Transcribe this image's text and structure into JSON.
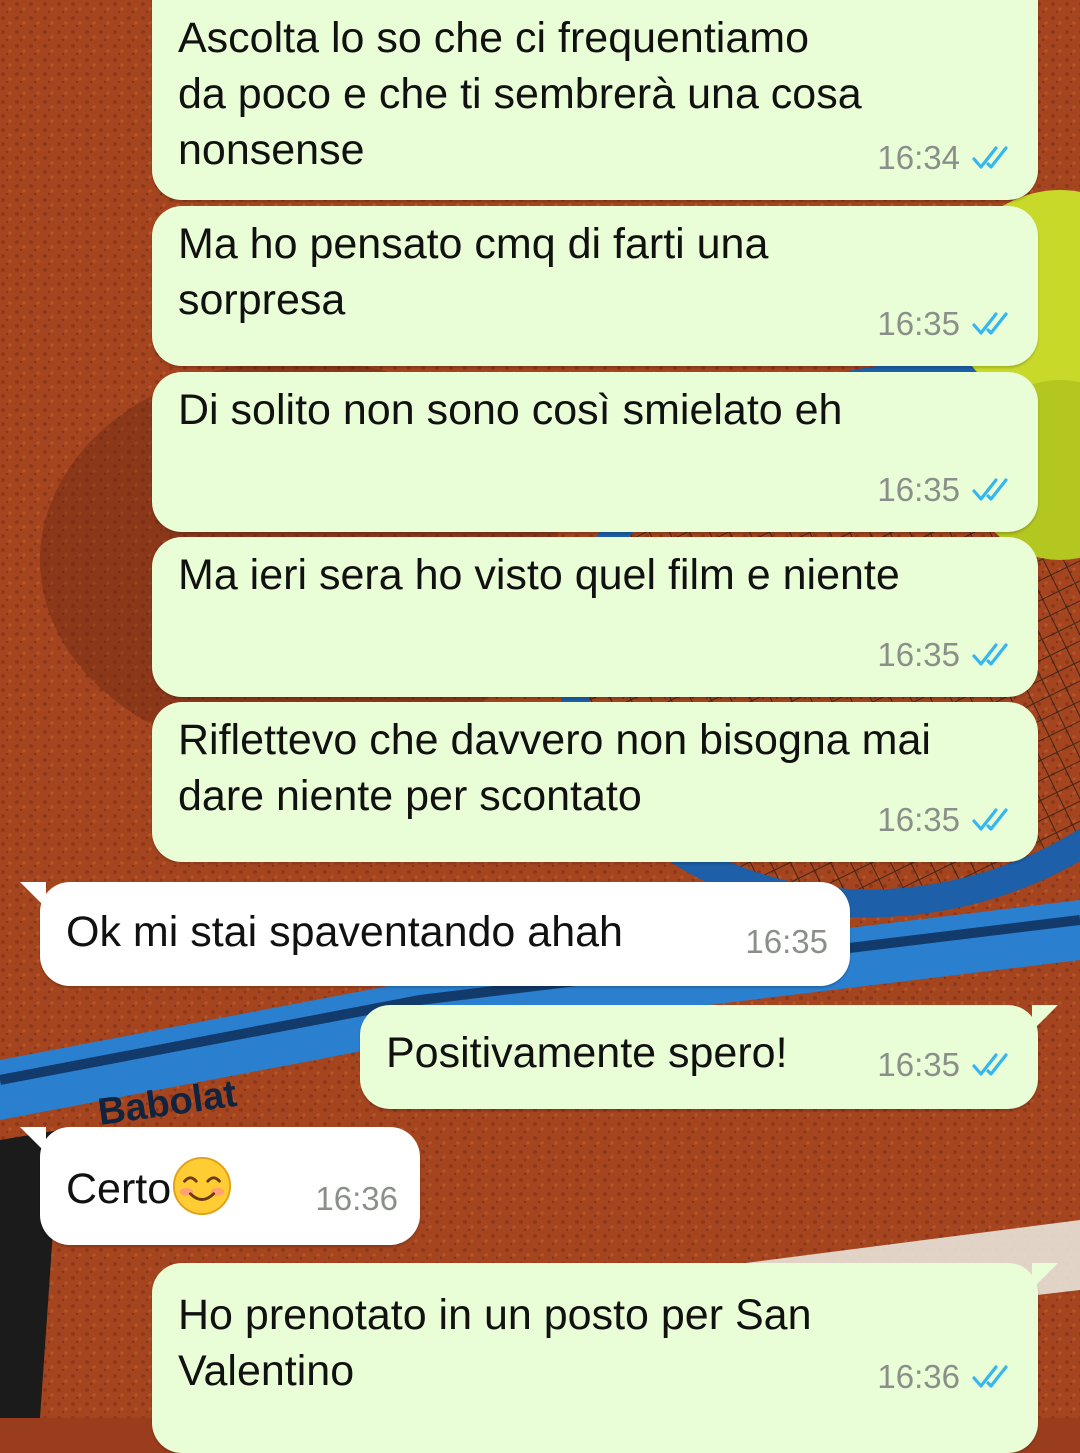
{
  "chat": {
    "messages": [
      {
        "direction": "out",
        "text": "Ascolta lo so che ci frequentiamo\nda poco e che ti sembrerà una cosa\nnonsense",
        "time": "16:34",
        "status": "read"
      },
      {
        "direction": "out",
        "text": "Ma ho pensato cmq di farti una\nsorpresa",
        "time": "16:35",
        "status": "read"
      },
      {
        "direction": "out",
        "text": "Di solito non sono così smielato eh",
        "time": "16:35",
        "status": "read"
      },
      {
        "direction": "out",
        "text": "Ma ieri sera ho visto quel film e niente",
        "time": "16:35",
        "status": "read"
      },
      {
        "direction": "out",
        "text": "Riflettevo che davvero non bisogna mai\ndare niente per scontato",
        "time": "16:35",
        "status": "read"
      },
      {
        "direction": "in",
        "text": "Ok mi stai spaventando ahah",
        "time": "16:35"
      },
      {
        "direction": "out",
        "text": "Positivamente spero!",
        "time": "16:35",
        "status": "read"
      },
      {
        "direction": "in",
        "text": "Certo",
        "emoji": "smiling-face-icon",
        "time": "16:36"
      },
      {
        "direction": "out",
        "text": "Ho prenotato in un posto per San\nValentino",
        "time": "16:36",
        "status": "read"
      }
    ]
  },
  "wallpaper": {
    "racket_brand": "Babolat"
  },
  "colors": {
    "outgoing_bubble": "#e9fdd6",
    "incoming_bubble": "#ffffff",
    "read_ticks": "#34b7f1",
    "timestamp": "#8b8f8a",
    "clay": "#9a3d1d"
  }
}
